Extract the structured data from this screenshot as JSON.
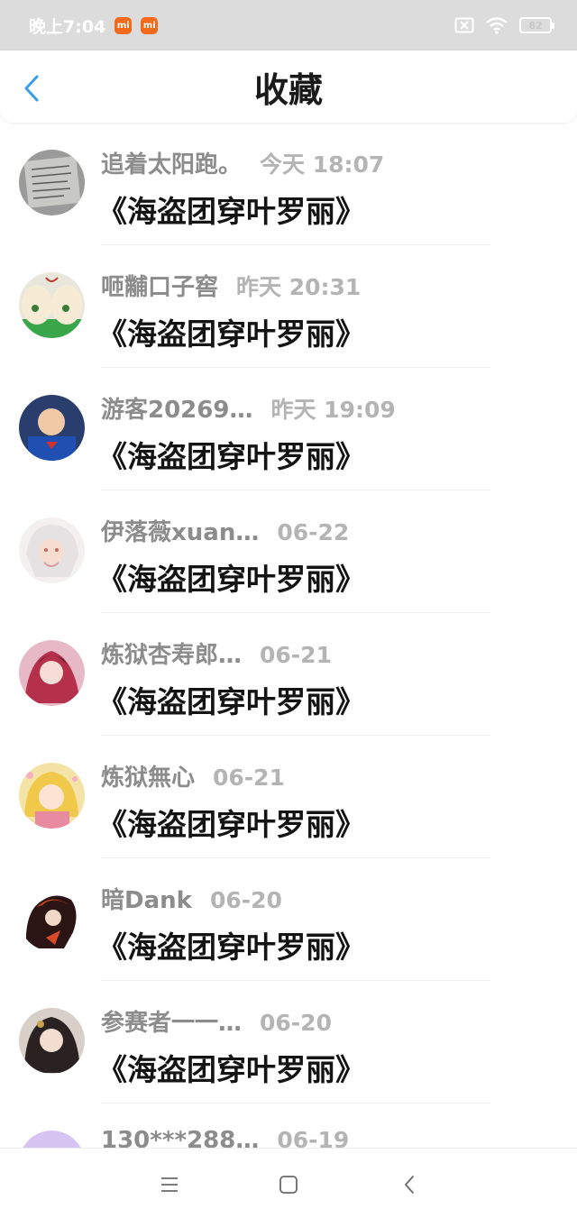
{
  "status_bar": {
    "time": "晚上7:04",
    "battery": "82",
    "battery_level": 0.82,
    "badge_color": "#f26a1b"
  },
  "header": {
    "title": "收藏",
    "accent": "#3a9ee8"
  },
  "items": [
    {
      "username": "追着太阳跑。",
      "time": "今天 18:07",
      "title": "《海盗团穿叶罗丽》",
      "avatar_icon": "handwriting-photo-avatar"
    },
    {
      "username": "咂黼口子窖",
      "time": "昨天 20:31",
      "title": "《海盗团穿叶罗丽》",
      "avatar_icon": "clover-eggs-avatar"
    },
    {
      "username": "游客20269…",
      "time": "昨天 19:09",
      "title": "《海盗团穿叶罗丽》",
      "avatar_icon": "child-superhero-avatar"
    },
    {
      "username": "伊落薇xuan…",
      "time": "06-22",
      "title": "《海盗团穿叶罗丽》",
      "avatar_icon": "anime-white-hair-avatar"
    },
    {
      "username": "炼狱杏寿郎…",
      "time": "06-21",
      "title": "《海盗团穿叶罗丽》",
      "avatar_icon": "anime-red-girl-avatar"
    },
    {
      "username": "炼狱無心",
      "time": "06-21",
      "title": "《海盗团穿叶罗丽》",
      "avatar_icon": "anime-blonde-girl-avatar"
    },
    {
      "username": "暗Dank",
      "time": "06-20",
      "title": "《海盗团穿叶罗丽》",
      "avatar_icon": "dark-red-figure-avatar"
    },
    {
      "username": "参赛者一一…",
      "time": "06-20",
      "title": "《海盗团穿叶罗丽》",
      "avatar_icon": "anime-dark-hair-avatar"
    },
    {
      "username": "130***288…",
      "time": "06-19",
      "title": "",
      "avatar_icon": "default-purple-avatar"
    }
  ],
  "nav": {
    "menu_icon": "menu-icon",
    "home_icon": "home-icon",
    "back_icon": "back-nav-icon"
  }
}
